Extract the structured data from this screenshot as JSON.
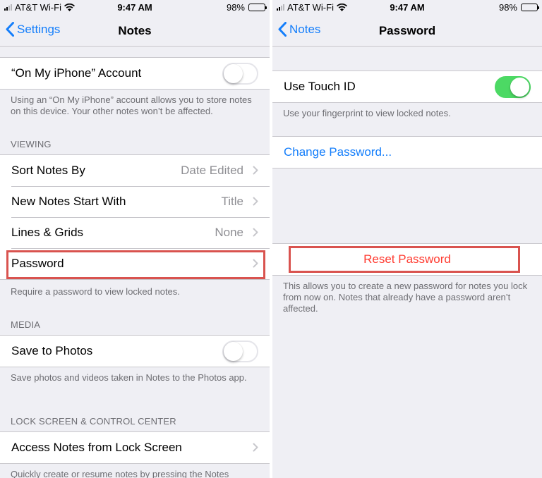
{
  "colors": {
    "accent": "#147efb",
    "toggle_on": "#4cd964",
    "destructive": "#ff3b30",
    "highlight_box": "#d9534f"
  },
  "left": {
    "status": {
      "carrier": "AT&T Wi-Fi",
      "time": "9:47 AM",
      "battery": "98%",
      "battery_level": 0.98
    },
    "nav": {
      "back": "Settings",
      "title": "Notes"
    },
    "account": {
      "label": "“On My iPhone” Account",
      "toggle_on": false,
      "footer": "Using an “On My iPhone” account allows you to store notes on this device. Your other notes won’t be affected."
    },
    "viewing": {
      "header": "VIEWING",
      "rows": [
        {
          "label": "Sort Notes By",
          "value": "Date Edited"
        },
        {
          "label": "New Notes Start With",
          "value": "Title"
        },
        {
          "label": "Lines & Grids",
          "value": "None"
        },
        {
          "label": "Password",
          "value": ""
        }
      ],
      "footer": "Require a password to view locked notes."
    },
    "media": {
      "header": "MEDIA",
      "label": "Save to Photos",
      "toggle_on": false,
      "footer": "Save photos and videos taken in Notes to the Photos app."
    },
    "lock": {
      "header": "LOCK SCREEN & CONTROL CENTER",
      "label": "Access Notes from Lock Screen",
      "footer": "Quickly create or resume notes by pressing the Notes"
    }
  },
  "right": {
    "status": {
      "carrier": "AT&T Wi-Fi",
      "time": "9:47 AM",
      "battery": "98%",
      "battery_level": 0.98
    },
    "nav": {
      "back": "Notes",
      "title": "Password"
    },
    "touch_id": {
      "label": "Use Touch ID",
      "toggle_on": true,
      "footer": "Use your fingerprint to view locked notes."
    },
    "change": {
      "label": "Change Password..."
    },
    "reset": {
      "label": "Reset Password",
      "footer": "This allows you to create a new password for notes you lock from now on. Notes that already have a password aren’t affected."
    }
  }
}
